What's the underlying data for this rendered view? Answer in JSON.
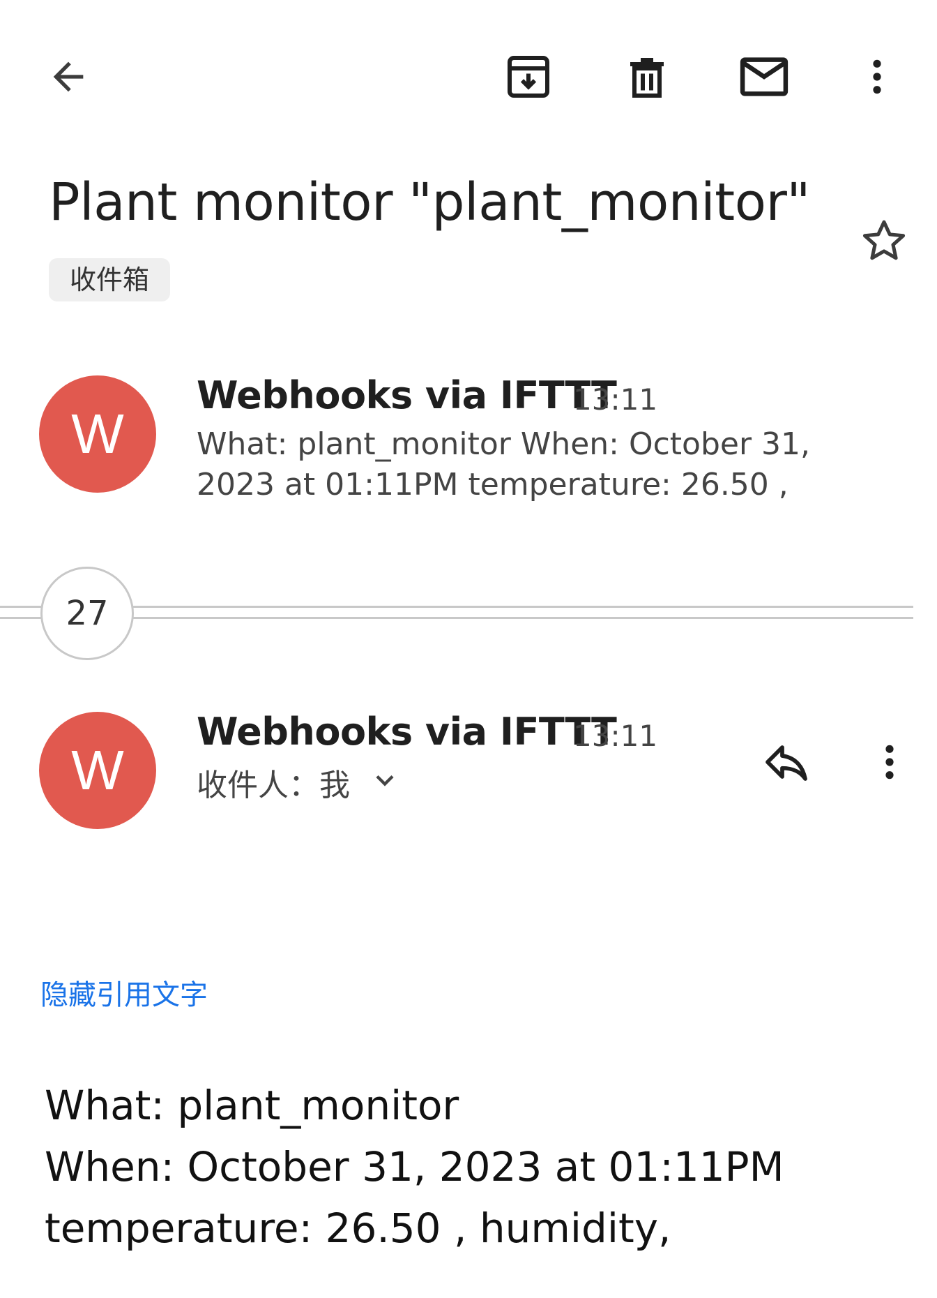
{
  "toolbar": {
    "back": "back-arrow-icon",
    "archive": "archive-icon",
    "delete": "trash-icon",
    "mark_unread": "mail-icon",
    "more": "more-vert-icon"
  },
  "thread": {
    "subject": "Plant monitor \"plant_monitor\"",
    "label": "收件箱",
    "starred": false
  },
  "message_collapsed": {
    "avatar_letter": "W",
    "sender": "Webhooks via IFTTT",
    "time": "13:11",
    "snippet": "What: plant_monitor When: October 31, 2023 at 01:11PM temperature: 26.50 ,"
  },
  "collapsed_count": "27",
  "message_expanded": {
    "avatar_letter": "W",
    "sender": "Webhooks via IFTTT",
    "time": "13:11",
    "recipient_label": "收件人：",
    "recipient": "我",
    "hide_quoted": "隐藏引用文字",
    "body": {
      "line1": "What: plant_monitor",
      "line2": "When: October 31, 2023 at 01:11PM",
      "line3": "temperature: 26.50 , humidity,"
    }
  },
  "colors": {
    "avatar": "#e1594f",
    "link": "#1a73e8",
    "chip": "#efefef"
  }
}
